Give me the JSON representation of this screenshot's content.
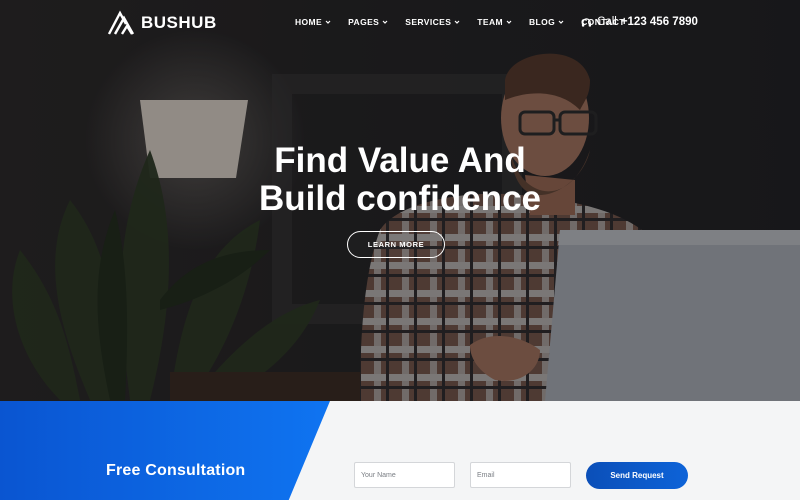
{
  "brand": {
    "name": "BUSHUB"
  },
  "nav": {
    "items": [
      {
        "label": "HOME",
        "dropdown": true
      },
      {
        "label": "PAGES",
        "dropdown": true
      },
      {
        "label": "SERVICES",
        "dropdown": true
      },
      {
        "label": "TEAM",
        "dropdown": true
      },
      {
        "label": "BLOG",
        "dropdown": true
      },
      {
        "label": "CONTACT",
        "dropdown": false
      }
    ],
    "phone_label": "Call",
    "phone_number": "+123 456 7890"
  },
  "hero": {
    "title_line1": "Find Value And",
    "title_line2": "Build confidence",
    "button_label": "LEARN MORE"
  },
  "consultation": {
    "title": "Free Consultation",
    "name_placeholder": "Your Name",
    "email_placeholder": "Email",
    "submit_label": "Send Request"
  },
  "colors": {
    "accent_blue": "#0f74f1",
    "accent_blue_dark": "#0a55d1",
    "hero_overlay": "#1b1a1b",
    "form_background": "#f4f5f6"
  },
  "icons": {
    "logo": "bushub-logo-icon",
    "phone": "headset-icon",
    "dropdown": "chevron-down-icon"
  }
}
